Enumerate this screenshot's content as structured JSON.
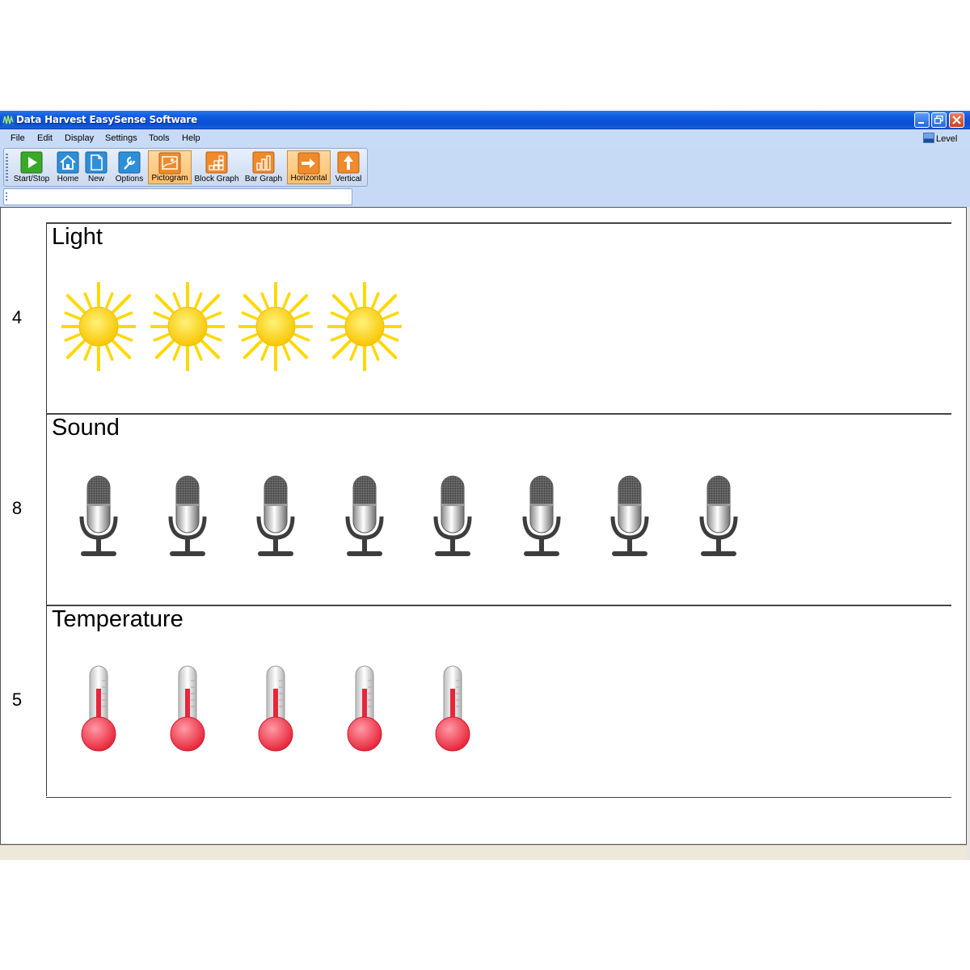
{
  "window": {
    "title": "Data Harvest EasySense Software"
  },
  "menu": [
    "File",
    "Edit",
    "Display",
    "Settings",
    "Tools",
    "Help"
  ],
  "level_label": "Level",
  "toolbar": [
    {
      "label": "Start/Stop",
      "icon": "play-icon",
      "active": false
    },
    {
      "label": "Home",
      "icon": "home-icon",
      "active": false
    },
    {
      "label": "New",
      "icon": "new-page-icon",
      "active": false
    },
    {
      "label": "Options",
      "icon": "wrench-icon",
      "active": false
    },
    {
      "label": "Pictogram",
      "icon": "pictogram-icon",
      "active": true
    },
    {
      "label": "Block Graph",
      "icon": "block-graph-icon",
      "active": false
    },
    {
      "label": "Bar Graph",
      "icon": "bar-graph-icon",
      "active": false
    },
    {
      "label": "Horizontal",
      "icon": "arrow-right-icon",
      "active": true
    },
    {
      "label": "Vertical",
      "icon": "arrow-up-icon",
      "active": false
    }
  ],
  "pictogram": [
    {
      "name": "Light",
      "value": 4,
      "icon": "sun-icon"
    },
    {
      "name": "Sound",
      "value": 8,
      "icon": "microphone-icon"
    },
    {
      "name": "Temperature",
      "value": 5,
      "icon": "thermometer-icon"
    }
  ],
  "colors": {
    "title_bar": "#0a4fd1",
    "active_button": "#ffbe6a",
    "sun": "#ffd800",
    "thermo_red": "#e8263a"
  }
}
